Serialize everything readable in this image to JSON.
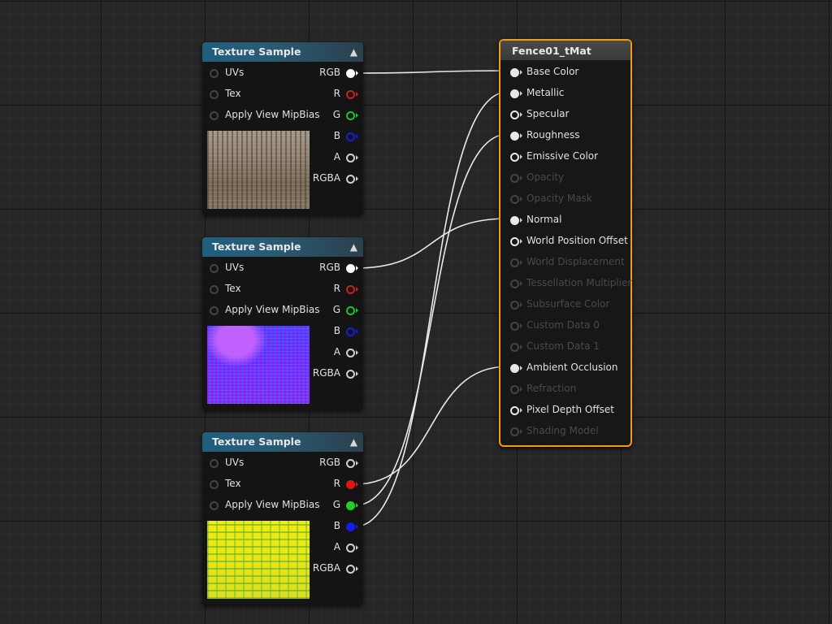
{
  "texture_nodes": [
    {
      "title": "Texture Sample",
      "inputs": [
        {
          "label": "UVs",
          "connected": false
        },
        {
          "label": "Tex",
          "connected": false
        },
        {
          "label": "Apply View MipBias",
          "connected": false
        }
      ],
      "outputs": [
        {
          "label": "RGB",
          "color": "#ffffff",
          "connected": true
        },
        {
          "label": "R",
          "color": "#d01f1f",
          "connected": false
        },
        {
          "label": "G",
          "color": "#22c222",
          "connected": false
        },
        {
          "label": "B",
          "color": "#1a1ae0",
          "connected": false
        },
        {
          "label": "A",
          "color": "#aaaaaa",
          "connected": false
        },
        {
          "label": "RGBA",
          "color": "#ffffff",
          "connected": false
        }
      ],
      "thumbnail": "base-color-texture"
    },
    {
      "title": "Texture Sample",
      "inputs": [
        {
          "label": "UVs",
          "connected": false
        },
        {
          "label": "Tex",
          "connected": false
        },
        {
          "label": "Apply View MipBias",
          "connected": false
        }
      ],
      "outputs": [
        {
          "label": "RGB",
          "color": "#ffffff",
          "connected": true
        },
        {
          "label": "R",
          "color": "#d01f1f",
          "connected": false
        },
        {
          "label": "G",
          "color": "#22c222",
          "connected": false
        },
        {
          "label": "B",
          "color": "#1a1ae0",
          "connected": false
        },
        {
          "label": "A",
          "color": "#aaaaaa",
          "connected": false
        },
        {
          "label": "RGBA",
          "color": "#ffffff",
          "connected": false
        }
      ],
      "thumbnail": "normal-map-texture"
    },
    {
      "title": "Texture Sample",
      "inputs": [
        {
          "label": "UVs",
          "connected": false
        },
        {
          "label": "Tex",
          "connected": false
        },
        {
          "label": "Apply View MipBias",
          "connected": false
        }
      ],
      "outputs": [
        {
          "label": "RGB",
          "color": "#ffffff",
          "connected": false
        },
        {
          "label": "R",
          "color": "#e51414",
          "connected": true
        },
        {
          "label": "G",
          "color": "#22d022",
          "connected": true
        },
        {
          "label": "B",
          "color": "#1a1ae8",
          "connected": true
        },
        {
          "label": "A",
          "color": "#aaaaaa",
          "connected": false
        },
        {
          "label": "RGBA",
          "color": "#ffffff",
          "connected": false
        }
      ],
      "thumbnail": "packed-mask-texture"
    }
  ],
  "material_node": {
    "title": "Fence01_tMat",
    "inputs": [
      {
        "label": "Base Color",
        "enabled": true,
        "connected": true
      },
      {
        "label": "Metallic",
        "enabled": true,
        "connected": true
      },
      {
        "label": "Specular",
        "enabled": true,
        "connected": false
      },
      {
        "label": "Roughness",
        "enabled": true,
        "connected": true
      },
      {
        "label": "Emissive Color",
        "enabled": true,
        "connected": false
      },
      {
        "label": "Opacity",
        "enabled": false,
        "connected": false
      },
      {
        "label": "Opacity Mask",
        "enabled": false,
        "connected": false
      },
      {
        "label": "Normal",
        "enabled": true,
        "connected": true
      },
      {
        "label": "World Position Offset",
        "enabled": true,
        "connected": false
      },
      {
        "label": "World Displacement",
        "enabled": false,
        "connected": false
      },
      {
        "label": "Tessellation Multiplier",
        "enabled": false,
        "connected": false
      },
      {
        "label": "Subsurface Color",
        "enabled": false,
        "connected": false
      },
      {
        "label": "Custom Data 0",
        "enabled": false,
        "connected": false
      },
      {
        "label": "Custom Data 1",
        "enabled": false,
        "connected": false
      },
      {
        "label": "Ambient Occlusion",
        "enabled": true,
        "connected": true
      },
      {
        "label": "Refraction",
        "enabled": false,
        "connected": false
      },
      {
        "label": "Pixel Depth Offset",
        "enabled": true,
        "connected": false
      },
      {
        "label": "Shading Model",
        "enabled": false,
        "connected": false
      }
    ]
  },
  "connections": [
    {
      "from_node": 0,
      "from_pin": "RGB",
      "to_pin": "Base Color"
    },
    {
      "from_node": 1,
      "from_pin": "RGB",
      "to_pin": "Normal"
    },
    {
      "from_node": 2,
      "from_pin": "R",
      "to_pin": "Ambient Occlusion"
    },
    {
      "from_node": 2,
      "from_pin": "G",
      "to_pin": "Roughness"
    },
    {
      "from_node": 2,
      "from_pin": "B",
      "to_pin": "Metallic"
    }
  ],
  "icons": {
    "collapse": "collapse-arrow-icon",
    "pin": "pin-icon",
    "pin_arrow": "pin-arrow-icon"
  }
}
